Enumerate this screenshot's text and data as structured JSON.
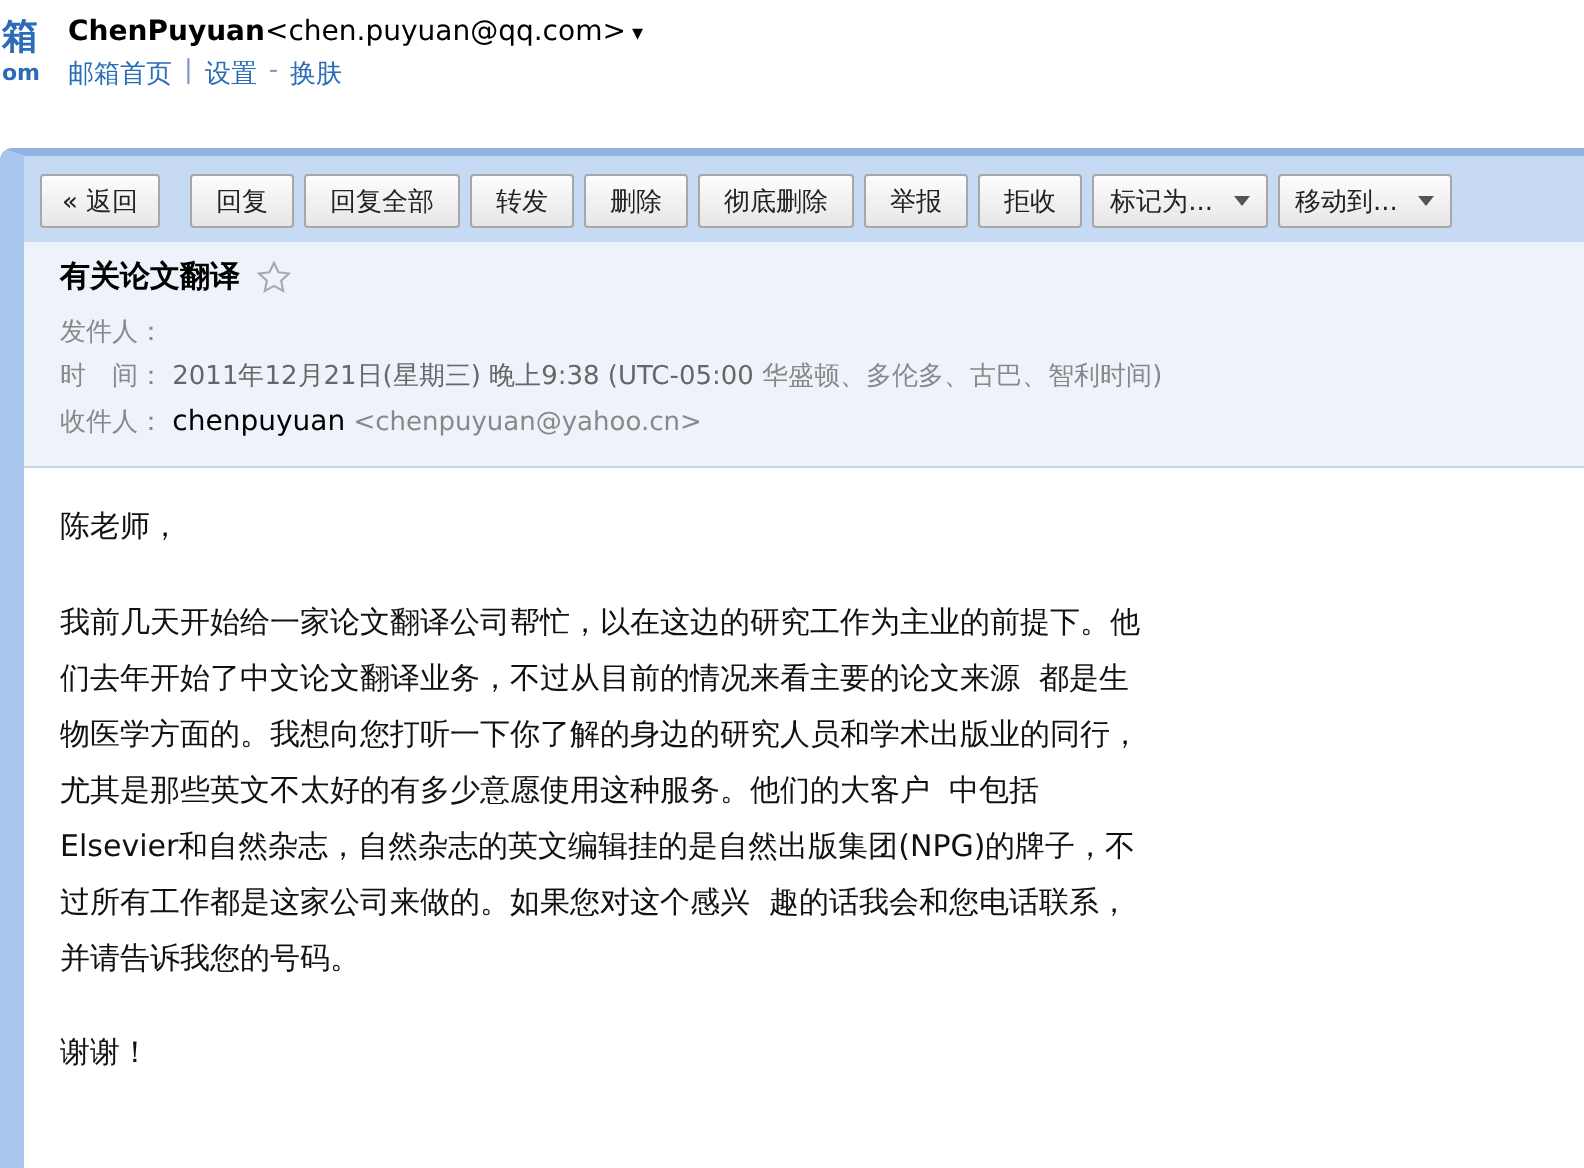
{
  "logo": {
    "glyph": "箱",
    "sub": "om"
  },
  "account": {
    "name": "ChenPuyuan",
    "email": "<chen.puyuan@qq.com>",
    "caret": "▾"
  },
  "header_links": [
    {
      "label": "邮箱首页"
    },
    {
      "label": "设置"
    },
    {
      "label": "换肤"
    }
  ],
  "header_separators": [
    "|",
    "-"
  ],
  "toolbar": [
    {
      "label": "« 返回",
      "kind": "plain"
    },
    {
      "label": "回复",
      "kind": "plain"
    },
    {
      "label": "回复全部",
      "kind": "plain"
    },
    {
      "label": "转发",
      "kind": "plain"
    },
    {
      "label": "删除",
      "kind": "plain"
    },
    {
      "label": "彻底删除",
      "kind": "plain"
    },
    {
      "label": "举报",
      "kind": "plain"
    },
    {
      "label": "拒收",
      "kind": "plain"
    },
    {
      "label": "标记为...",
      "kind": "dropdown"
    },
    {
      "label": "移动到...",
      "kind": "dropdown"
    }
  ],
  "message": {
    "subject": "有关论文翻译",
    "starred": false,
    "from_label": "发件人：",
    "time_label": "时　间：",
    "time_value": "2011年12月21日(星期三) 晚上9:38 (UTC-05:00",
    "time_zone": "华盛顿、多伦多、古巴、智利时间)",
    "to_label": "收件人：",
    "to_name": "chenpuyuan",
    "to_email": "<chenpuyuan@yahoo.cn>"
  },
  "body": {
    "greeting": "陈老师，",
    "paragraph_lines": [
      "我前几天开始给一家论文翻译公司帮忙，以在这边的研究工作为主业的前提下。他",
      "们去年开始了中文论文翻译业务，不过从目前的情况来看主要的论文来源  都是生",
      "物医学方面的。我想向您打听一下你了解的身边的研究人员和学术出版业的同行，",
      "尤其是那些英文不太好的有多少意愿使用这种服务。他们的大客户  中包括",
      "Elsevier和自然杂志，自然杂志的英文编辑挂的是自然出版集团(NPG)的牌子，不",
      "过所有工作都是这家公司来做的。如果您对这个感兴  趣的话我会和您电话联系，",
      "并请告诉我您的号码。"
    ],
    "closing": "谢谢！"
  }
}
